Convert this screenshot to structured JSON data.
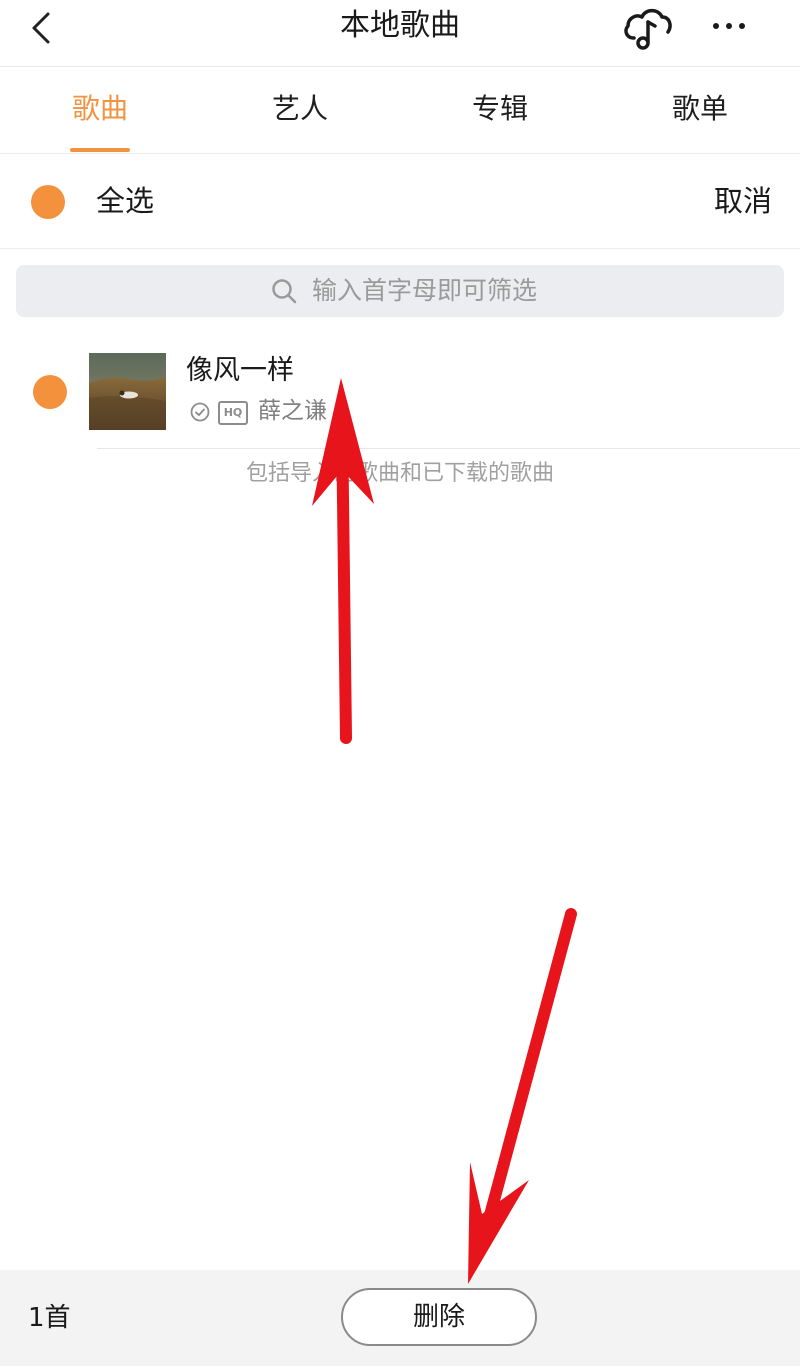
{
  "header": {
    "title": "本地歌曲",
    "back_icon": "chevron-left-icon",
    "cloud_icon": "cloud-music-icon",
    "more_icon": "more-horizontal-icon"
  },
  "tabs": [
    {
      "label": "歌曲",
      "active": true
    },
    {
      "label": "艺人",
      "active": false
    },
    {
      "label": "专辑",
      "active": false
    },
    {
      "label": "歌单",
      "active": false
    }
  ],
  "select_bar": {
    "select_all_label": "全选",
    "cancel_label": "取消"
  },
  "search": {
    "placeholder": "输入首字母即可筛选"
  },
  "songs": [
    {
      "title": "像风一样",
      "artist": "薛之谦",
      "quality_badge": "HQ",
      "selected": true,
      "downloaded": true
    }
  ],
  "footnote": "包括导入的歌曲和已下载的歌曲",
  "bottom_bar": {
    "count_label": "1首",
    "delete_label": "删除"
  },
  "colors": {
    "accent": "#f29340",
    "annotation_arrow": "#e8141b"
  }
}
